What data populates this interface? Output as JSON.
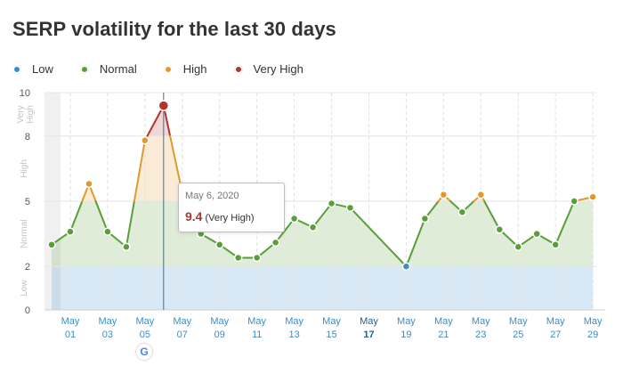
{
  "title": "SERP volatility for the last 30 days",
  "legend": [
    {
      "label": "Low",
      "color": "#3b8ec9"
    },
    {
      "label": "Normal",
      "color": "#5a9e3a"
    },
    {
      "label": "High",
      "color": "#e09a2b"
    },
    {
      "label": "Very High",
      "color": "#b3342b"
    }
  ],
  "tooltip": {
    "date": "May 6, 2020",
    "value": "9.4",
    "level": "(Very High)"
  },
  "google_icon": "G",
  "chart_data": {
    "type": "area",
    "title": "SERP volatility for the last 30 days",
    "ylim": [
      0,
      10
    ],
    "y_ticks": [
      "0",
      "2",
      "5",
      "8",
      "10"
    ],
    "bands": [
      {
        "label": "Low",
        "from": 0,
        "to": 2,
        "color": "#3b8ec9"
      },
      {
        "label": "Normal",
        "from": 2,
        "to": 5,
        "color": "#5a9e3a"
      },
      {
        "label": "High",
        "from": 5,
        "to": 8,
        "color": "#e09a2b"
      },
      {
        "label": "Very High",
        "from": 8,
        "to": 10,
        "color": "#b3342b"
      }
    ],
    "band_labels": [
      "Low",
      "Normal",
      "High",
      "Very High"
    ],
    "x_tick_labels": [
      {
        "month": "May",
        "day": "01",
        "day_index": 1
      },
      {
        "month": "May",
        "day": "03",
        "day_index": 3
      },
      {
        "month": "May",
        "day": "05",
        "day_index": 5
      },
      {
        "month": "May",
        "day": "07",
        "day_index": 7
      },
      {
        "month": "May",
        "day": "09",
        "day_index": 9
      },
      {
        "month": "May",
        "day": "11",
        "day_index": 11
      },
      {
        "month": "May",
        "day": "13",
        "day_index": 13
      },
      {
        "month": "May",
        "day": "15",
        "day_index": 15
      },
      {
        "month": "May",
        "day": "17",
        "day_index": 17
      },
      {
        "month": "May",
        "day": "19",
        "day_index": 19
      },
      {
        "month": "May",
        "day": "21",
        "day_index": 21
      },
      {
        "month": "May",
        "day": "23",
        "day_index": 23
      },
      {
        "month": "May",
        "day": "25",
        "day_index": 25
      },
      {
        "month": "May",
        "day": "27",
        "day_index": 27
      },
      {
        "month": "May",
        "day": "29",
        "day_index": 29
      }
    ],
    "series": [
      {
        "x": [
          "Apr 30",
          "May 1",
          "May 2",
          "May 3",
          "May 4",
          "May 5",
          "May 6",
          "May 7",
          "May 8",
          "May 9",
          "May 10",
          "May 11",
          "May 12",
          "May 13",
          "May 14",
          "May 15",
          "May 16",
          "May 19",
          "May 20",
          "May 21",
          "May 22",
          "May 23",
          "May 24",
          "May 25",
          "May 26",
          "May 27",
          "May 28",
          "May 29"
        ],
        "day_index": [
          0,
          1,
          2,
          3,
          4,
          5,
          6,
          7,
          8,
          9,
          10,
          11,
          12,
          13,
          14,
          15,
          16,
          19,
          20,
          21,
          22,
          23,
          24,
          25,
          26,
          27,
          28,
          29
        ],
        "values": [
          3.0,
          3.6,
          5.8,
          3.6,
          2.9,
          7.8,
          9.4,
          5.4,
          3.5,
          3.0,
          2.4,
          2.4,
          3.1,
          4.2,
          3.8,
          4.9,
          4.7,
          2.0,
          4.2,
          5.3,
          4.5,
          5.3,
          3.7,
          2.9,
          3.5,
          3.0,
          5.0,
          5.2
        ]
      }
    ],
    "highlight": {
      "x": "May 6",
      "day_index": 6,
      "value": 9.4
    }
  }
}
